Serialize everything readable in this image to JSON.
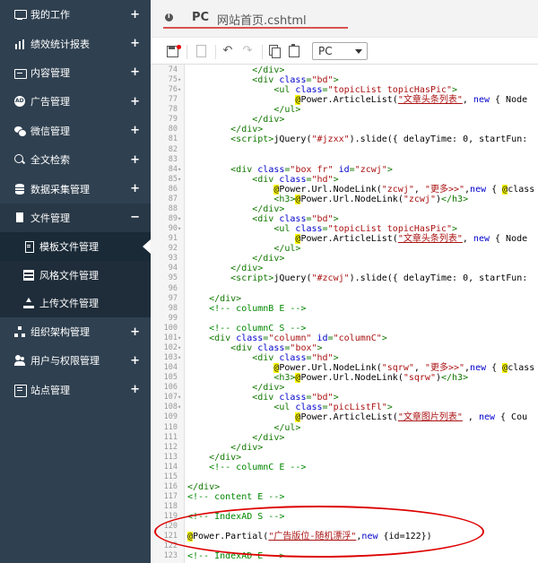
{
  "sidebar": {
    "items_top": [
      {
        "label": "我的工作",
        "icon": "monitor-icon"
      },
      {
        "label": "绩效统计报表",
        "icon": "bar-chart-icon"
      },
      {
        "label": "内容管理",
        "icon": "inbox-icon"
      },
      {
        "label": "广告管理",
        "icon": "ad-icon"
      },
      {
        "label": "微信管理",
        "icon": "wechat-icon"
      },
      {
        "label": "全文检索",
        "icon": "search-icon"
      },
      {
        "label": "数据采集管理",
        "icon": "database-icon"
      }
    ],
    "open_item": {
      "label": "文件管理",
      "icon": "file-icon",
      "expander": "−"
    },
    "sub_items": [
      {
        "label": "模板文件管理",
        "icon": "file-text-icon",
        "active": true
      },
      {
        "label": "风格文件管理",
        "icon": "table-icon"
      },
      {
        "label": "上传文件管理",
        "icon": "upload-icon"
      }
    ],
    "items_bottom": [
      {
        "label": "组织架构管理",
        "icon": "sitemap-icon"
      },
      {
        "label": "用户与权限管理",
        "icon": "users-icon"
      },
      {
        "label": "站点管理",
        "icon": "list-icon"
      }
    ],
    "expander": "+"
  },
  "tab": {
    "platform": "PC",
    "filename": "网站首页.cshtml"
  },
  "toolbar": {
    "select_value": "PC"
  },
  "colors": {
    "sidebar_bg": "#2f4050",
    "annotation": "#dd0000",
    "tag": "#117700",
    "keyword": "#0000cc",
    "string": "#aa1111",
    "comment": "#008800"
  },
  "code": [
    {
      "n": "74",
      "f": "",
      "segs": [
        [
          "t-tag",
          "            </div>"
        ]
      ]
    },
    {
      "n": "75",
      "f": "▾",
      "segs": [
        [
          "t-tag",
          "            <div "
        ],
        [
          "t-kw",
          "class"
        ],
        [
          "t-tag",
          "="
        ],
        [
          "t-str",
          "\"bd\""
        ],
        [
          "t-tag",
          ">"
        ]
      ]
    },
    {
      "n": "76",
      "f": "▾",
      "segs": [
        [
          "t-tag",
          "                <ul "
        ],
        [
          "t-kw",
          "class"
        ],
        [
          "t-tag",
          "="
        ],
        [
          "t-str",
          "\"topicList topicHasPic\""
        ],
        [
          "t-tag",
          ">"
        ]
      ]
    },
    {
      "n": "77",
      "f": "",
      "segs": [
        [
          "t-plain",
          "                    "
        ],
        [
          "t-at",
          "@"
        ],
        [
          "t-plain",
          "Power.ArticleList("
        ],
        [
          "t-und",
          "\"文章头条列表\""
        ],
        [
          "t-plain",
          ", "
        ],
        [
          "t-kw",
          "new"
        ],
        [
          "t-plain",
          " { Node"
        ]
      ]
    },
    {
      "n": "78",
      "f": "",
      "segs": [
        [
          "t-tag",
          "                </ul>"
        ]
      ]
    },
    {
      "n": "79",
      "f": "",
      "segs": [
        [
          "t-tag",
          "            </div>"
        ]
      ]
    },
    {
      "n": "80",
      "f": "",
      "segs": [
        [
          "t-tag",
          "        </div>"
        ]
      ]
    },
    {
      "n": "81",
      "f": "",
      "segs": [
        [
          "t-tag",
          "        <script>"
        ],
        [
          "t-plain",
          "jQuery("
        ],
        [
          "t-str",
          "\"#jzxx\""
        ],
        [
          "t-plain",
          ").slide({ delayTime: 0, startFun:"
        ]
      ]
    },
    {
      "n": "82",
      "f": "",
      "segs": []
    },
    {
      "n": "83",
      "f": "",
      "segs": []
    },
    {
      "n": "84",
      "f": "▾",
      "segs": [
        [
          "t-tag",
          "        <div "
        ],
        [
          "t-kw",
          "class"
        ],
        [
          "t-tag",
          "="
        ],
        [
          "t-str",
          "\"box fr\""
        ],
        [
          "t-tag",
          " "
        ],
        [
          "t-kw",
          "id"
        ],
        [
          "t-tag",
          "="
        ],
        [
          "t-str",
          "\"zcwj\""
        ],
        [
          "t-tag",
          ">"
        ]
      ]
    },
    {
      "n": "85",
      "f": "▾",
      "segs": [
        [
          "t-tag",
          "            <div "
        ],
        [
          "t-kw",
          "class"
        ],
        [
          "t-tag",
          "="
        ],
        [
          "t-str",
          "\"hd\""
        ],
        [
          "t-tag",
          ">"
        ]
      ]
    },
    {
      "n": "86",
      "f": "",
      "segs": [
        [
          "t-plain",
          "                "
        ],
        [
          "t-at",
          "@"
        ],
        [
          "t-plain",
          "Power.Url.NodeLink("
        ],
        [
          "t-str",
          "\"zcwj\""
        ],
        [
          "t-plain",
          ", "
        ],
        [
          "t-str",
          "\"更多>>\""
        ],
        [
          "t-plain",
          ","
        ],
        [
          "t-kw",
          "new"
        ],
        [
          "t-plain",
          " { "
        ],
        [
          "t-at",
          "@"
        ],
        [
          "t-plain",
          "class"
        ]
      ]
    },
    {
      "n": "87",
      "f": "",
      "segs": [
        [
          "t-tag",
          "                <h3>"
        ],
        [
          "t-at",
          "@"
        ],
        [
          "t-plain",
          "Power.Url.NodeLink("
        ],
        [
          "t-str",
          "\"zcwj\""
        ],
        [
          "t-plain",
          ")"
        ],
        [
          "t-tag",
          "</h3>"
        ]
      ]
    },
    {
      "n": "88",
      "f": "",
      "segs": [
        [
          "t-tag",
          "            </div>"
        ]
      ]
    },
    {
      "n": "89",
      "f": "▾",
      "segs": [
        [
          "t-tag",
          "            <div "
        ],
        [
          "t-kw",
          "class"
        ],
        [
          "t-tag",
          "="
        ],
        [
          "t-str",
          "\"bd\""
        ],
        [
          "t-tag",
          ">"
        ]
      ]
    },
    {
      "n": "90",
      "f": "▾",
      "segs": [
        [
          "t-tag",
          "                <ul "
        ],
        [
          "t-kw",
          "class"
        ],
        [
          "t-tag",
          "="
        ],
        [
          "t-str",
          "\"topicList topicHasPic\""
        ],
        [
          "t-tag",
          ">"
        ]
      ]
    },
    {
      "n": "91",
      "f": "",
      "segs": [
        [
          "t-plain",
          "                    "
        ],
        [
          "t-at",
          "@"
        ],
        [
          "t-plain",
          "Power.ArticleList("
        ],
        [
          "t-und",
          "\"文章头条列表\""
        ],
        [
          "t-plain",
          ", "
        ],
        [
          "t-kw",
          "new"
        ],
        [
          "t-plain",
          " { Node"
        ]
      ]
    },
    {
      "n": "92",
      "f": "",
      "segs": [
        [
          "t-tag",
          "                </ul>"
        ]
      ]
    },
    {
      "n": "93",
      "f": "",
      "segs": [
        [
          "t-tag",
          "            </div>"
        ]
      ]
    },
    {
      "n": "94",
      "f": "",
      "segs": [
        [
          "t-tag",
          "        </div>"
        ]
      ]
    },
    {
      "n": "95",
      "f": "",
      "segs": [
        [
          "t-tag",
          "        <script>"
        ],
        [
          "t-plain",
          "jQuery("
        ],
        [
          "t-str",
          "\"#zcwj\""
        ],
        [
          "t-plain",
          ").slide({ delayTime: 0, startFun:"
        ]
      ]
    },
    {
      "n": "96",
      "f": "",
      "segs": []
    },
    {
      "n": "97",
      "f": "",
      "segs": [
        [
          "t-tag",
          "    </div>"
        ]
      ]
    },
    {
      "n": "98",
      "f": "",
      "segs": [
        [
          "t-cmt",
          "    <!-- columnB E -->"
        ]
      ]
    },
    {
      "n": "99",
      "f": "",
      "segs": []
    },
    {
      "n": "100",
      "f": "",
      "segs": [
        [
          "t-cmt",
          "    <!-- columnC S -->"
        ]
      ]
    },
    {
      "n": "101",
      "f": "▾",
      "segs": [
        [
          "t-tag",
          "    <div "
        ],
        [
          "t-kw",
          "class"
        ],
        [
          "t-tag",
          "="
        ],
        [
          "t-str",
          "\"column\""
        ],
        [
          "t-tag",
          " "
        ],
        [
          "t-kw",
          "id"
        ],
        [
          "t-tag",
          "="
        ],
        [
          "t-str",
          "\"columnC\""
        ],
        [
          "t-tag",
          ">"
        ]
      ]
    },
    {
      "n": "102",
      "f": "▾",
      "segs": [
        [
          "t-tag",
          "        <div "
        ],
        [
          "t-kw",
          "class"
        ],
        [
          "t-tag",
          "="
        ],
        [
          "t-str",
          "\"box\""
        ],
        [
          "t-tag",
          ">"
        ]
      ]
    },
    {
      "n": "103",
      "f": "▾",
      "segs": [
        [
          "t-tag",
          "            <div "
        ],
        [
          "t-kw",
          "class"
        ],
        [
          "t-tag",
          "="
        ],
        [
          "t-str",
          "\"hd\""
        ],
        [
          "t-tag",
          ">"
        ]
      ]
    },
    {
      "n": "104",
      "f": "",
      "segs": [
        [
          "t-plain",
          "                "
        ],
        [
          "t-at",
          "@"
        ],
        [
          "t-plain",
          "Power.Url.NodeLink("
        ],
        [
          "t-str",
          "\"sqrw\""
        ],
        [
          "t-plain",
          ", "
        ],
        [
          "t-str",
          "\"更多>>\""
        ],
        [
          "t-plain",
          ","
        ],
        [
          "t-kw",
          "new"
        ],
        [
          "t-plain",
          " { "
        ],
        [
          "t-at",
          "@"
        ],
        [
          "t-plain",
          "class"
        ]
      ]
    },
    {
      "n": "105",
      "f": "",
      "segs": [
        [
          "t-tag",
          "                <h3>"
        ],
        [
          "t-at",
          "@"
        ],
        [
          "t-plain",
          "Power.Url.NodeLink("
        ],
        [
          "t-str",
          "\"sqrw\""
        ],
        [
          "t-plain",
          ")"
        ],
        [
          "t-tag",
          "</h3>"
        ]
      ]
    },
    {
      "n": "106",
      "f": "",
      "segs": [
        [
          "t-tag",
          "            </div>"
        ]
      ]
    },
    {
      "n": "107",
      "f": "▾",
      "segs": [
        [
          "t-tag",
          "            <div "
        ],
        [
          "t-kw",
          "class"
        ],
        [
          "t-tag",
          "="
        ],
        [
          "t-str",
          "\"bd\""
        ],
        [
          "t-tag",
          ">"
        ]
      ]
    },
    {
      "n": "108",
      "f": "▾",
      "segs": [
        [
          "t-tag",
          "                <ul "
        ],
        [
          "t-kw",
          "class"
        ],
        [
          "t-tag",
          "="
        ],
        [
          "t-str",
          "\"picListFl\""
        ],
        [
          "t-tag",
          ">"
        ]
      ]
    },
    {
      "n": "109",
      "f": "",
      "segs": [
        [
          "t-plain",
          "                    "
        ],
        [
          "t-at",
          "@"
        ],
        [
          "t-plain",
          "Power.ArticleList("
        ],
        [
          "t-und",
          "\"文章图片列表\""
        ],
        [
          "t-plain",
          " , "
        ],
        [
          "t-kw",
          "new"
        ],
        [
          "t-plain",
          " { Cou"
        ]
      ]
    },
    {
      "n": "110",
      "f": "",
      "segs": [
        [
          "t-tag",
          "                </ul>"
        ]
      ]
    },
    {
      "n": "111",
      "f": "",
      "segs": [
        [
          "t-tag",
          "            </div>"
        ]
      ]
    },
    {
      "n": "112",
      "f": "",
      "segs": [
        [
          "t-tag",
          "        </div>"
        ]
      ]
    },
    {
      "n": "113",
      "f": "",
      "segs": [
        [
          "t-tag",
          "    </div>"
        ]
      ]
    },
    {
      "n": "114",
      "f": "",
      "segs": [
        [
          "t-cmt",
          "    <!-- columnC E -->"
        ]
      ]
    },
    {
      "n": "115",
      "f": "",
      "segs": []
    },
    {
      "n": "116",
      "f": "",
      "segs": [
        [
          "t-tag",
          "</div>"
        ]
      ]
    },
    {
      "n": "117",
      "f": "",
      "segs": [
        [
          "t-cmt",
          "<!-- content E -->"
        ]
      ]
    },
    {
      "n": "118",
      "f": "",
      "segs": []
    },
    {
      "n": "119",
      "f": "",
      "segs": [
        [
          "t-cmt",
          "<!-- IndexAD S -->"
        ]
      ]
    },
    {
      "n": "120",
      "f": "",
      "segs": []
    },
    {
      "n": "121",
      "f": "",
      "segs": [
        [
          "t-at",
          "@"
        ],
        [
          "t-plain",
          "Power.Partial("
        ],
        [
          "t-und",
          "\"广告版位-随机漂浮\""
        ],
        [
          "t-plain",
          ","
        ],
        [
          "t-kw",
          "new"
        ],
        [
          "t-plain",
          " {id=122})"
        ]
      ]
    },
    {
      "n": "122",
      "f": "",
      "segs": []
    },
    {
      "n": "123",
      "f": "",
      "segs": [
        [
          "t-cmt",
          "<!-- IndexAD E -->"
        ]
      ]
    }
  ]
}
